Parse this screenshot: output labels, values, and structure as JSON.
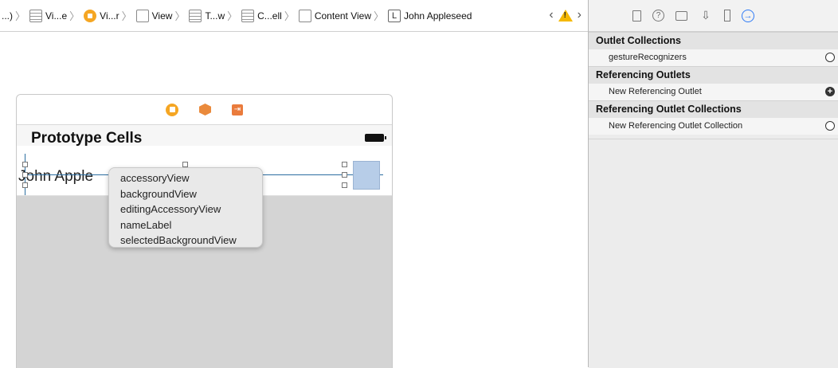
{
  "breadcrumb": {
    "items": [
      {
        "label": "...)",
        "icon": "none"
      },
      {
        "label": "Vi...e",
        "icon": "storyboard-icon"
      },
      {
        "label": "Vi...r",
        "icon": "view-controller-icon"
      },
      {
        "label": "View",
        "icon": "view-icon"
      },
      {
        "label": "T...w",
        "icon": "table-view-icon"
      },
      {
        "label": "C...ell",
        "icon": "table-cell-icon"
      },
      {
        "label": "Content View",
        "icon": "view-icon"
      },
      {
        "label": "John Appleseed",
        "icon": "label-icon",
        "glyph": "L"
      }
    ],
    "separator": "〉",
    "nav_back": "‹",
    "nav_forward": "›",
    "warning_glyph": "!"
  },
  "scene": {
    "title": "Prototype Cells",
    "cell_label": "John Apple",
    "dock_exit_glyph": "⇥"
  },
  "popup": {
    "items": [
      "accessoryView",
      "backgroundView",
      "editingAccessoryView",
      "nameLabel",
      "selectedBackgroundView"
    ]
  },
  "inspector": {
    "tabs": [
      "file-inspector-icon",
      "help-icon",
      "identity-icon",
      "attributes-icon",
      "size-icon",
      "connections-icon"
    ],
    "sections": [
      {
        "title": "Outlet Collections",
        "row": "gestureRecognizers",
        "connector": "empty"
      },
      {
        "title": "Referencing Outlets",
        "row": "New Referencing Outlet",
        "connector": "plus"
      },
      {
        "title": "Referencing Outlet Collections",
        "row": "New Referencing Outlet Collection",
        "connector": "empty"
      }
    ]
  },
  "colors": {
    "accent": "#2f7bf6",
    "vc_orange": "#f5a623",
    "selection_line": "#2c6ea1"
  }
}
